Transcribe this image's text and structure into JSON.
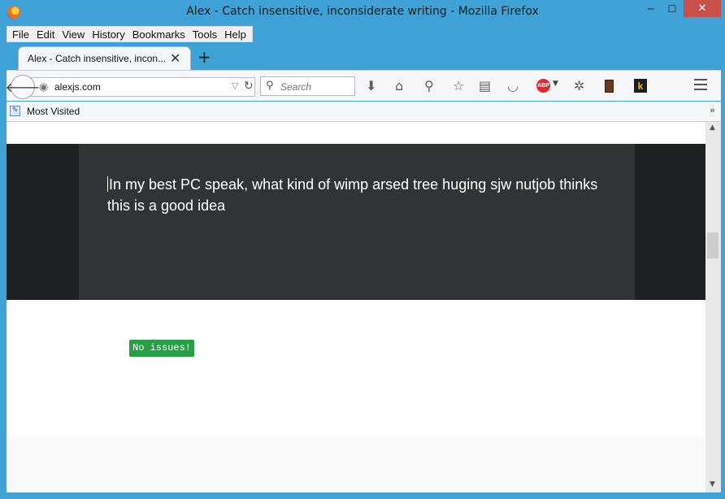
{
  "window": {
    "title": "Alex - Catch insensitive, inconsiderate writing - Mozilla Firefox",
    "minimize": "─",
    "maximize": "☐",
    "close": "✕"
  },
  "menubar": {
    "items": [
      {
        "label": "File"
      },
      {
        "label": "Edit"
      },
      {
        "label": "View"
      },
      {
        "label": "History"
      },
      {
        "label": "Bookmarks"
      },
      {
        "label": "Tools"
      },
      {
        "label": "Help"
      }
    ]
  },
  "tabs": {
    "active_label": "Alex - Catch insensitive, incon...",
    "close": "✕",
    "new_tab": "+"
  },
  "navbar": {
    "back": "🡐",
    "url": "alexjs.com",
    "search_placeholder": "Search",
    "icons": [
      "download-icon",
      "home-icon",
      "zoom-icon",
      "bookmark-star-icon",
      "reader-list-icon",
      "pocket-icon",
      "adblock-plus-icon",
      "settings-gear-icon",
      "extension-icon",
      "k-extension-icon",
      "hamburger-menu-icon"
    ],
    "abp_label": "ABP",
    "k_label": "k"
  },
  "bookmarks": {
    "label": "Most Visited",
    "more": "»"
  },
  "editor": {
    "text": "In my best PC speak, what kind of wimp arsed tree huging sjw nutjob thinks this is a good idea"
  },
  "result": {
    "badge": "No issues!",
    "badge_color": "#27a045"
  }
}
